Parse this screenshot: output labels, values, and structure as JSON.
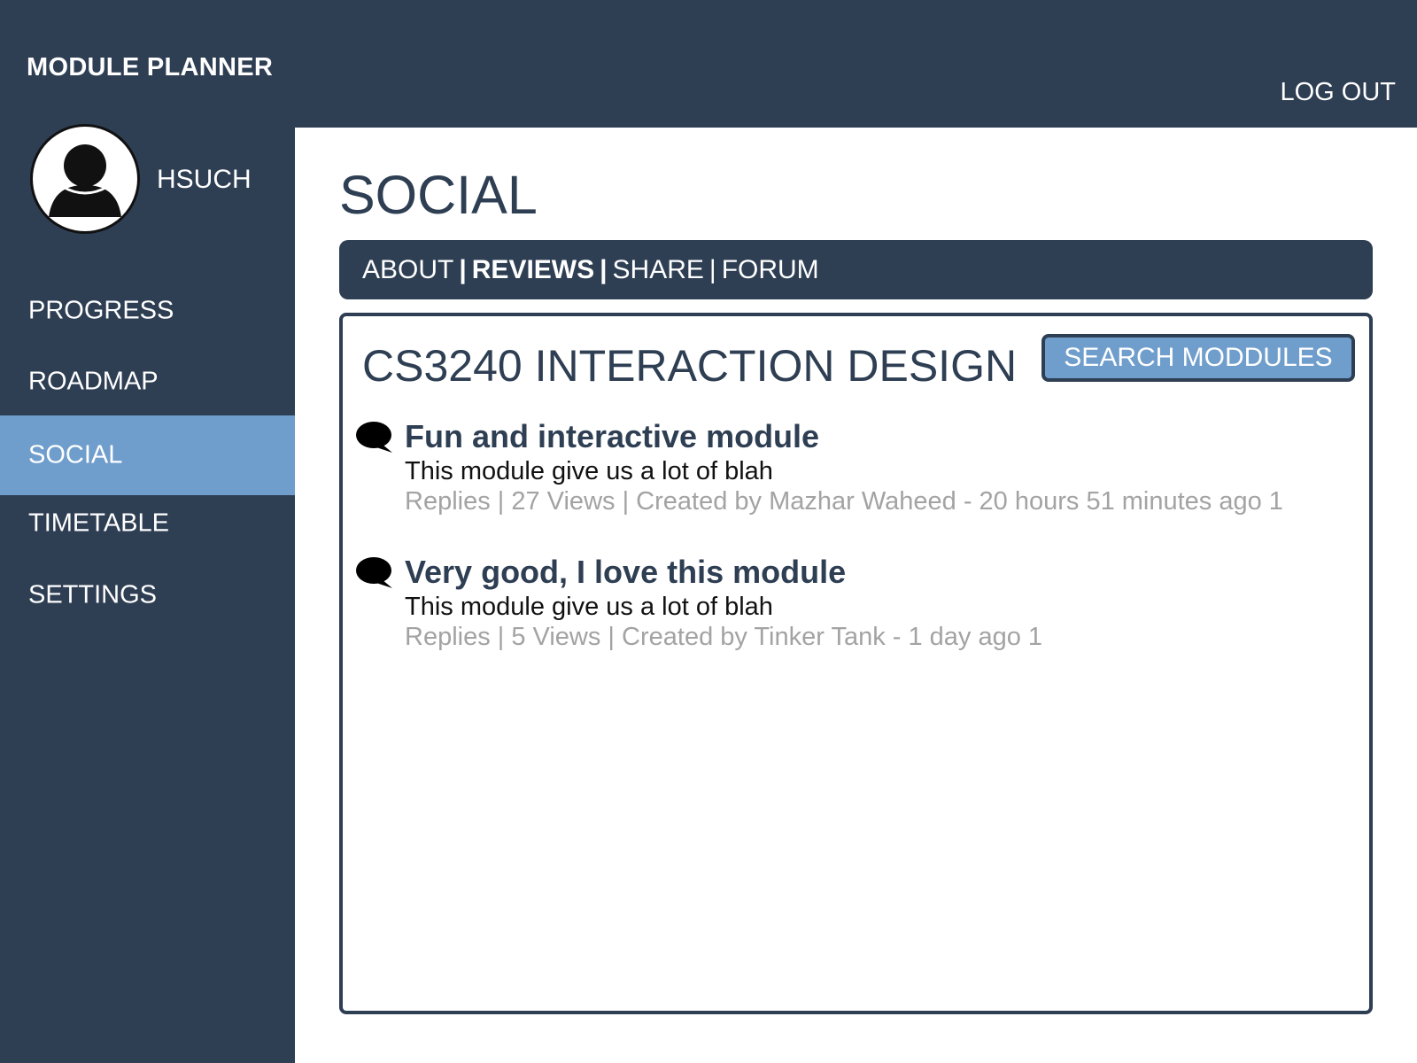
{
  "app": {
    "title": "MODULE PLANNER",
    "logout_label": "LOG OUT"
  },
  "user": {
    "name": "HSUCH",
    "avatar_icon": "user-silhouette-icon"
  },
  "sidebar": {
    "items": [
      {
        "label": "PROGRESS"
      },
      {
        "label": "ROADMAP"
      },
      {
        "label": "SOCIAL"
      },
      {
        "label": "TIMETABLE"
      },
      {
        "label": "SETTINGS"
      }
    ],
    "active": "SOCIAL"
  },
  "main": {
    "title": "SOCIAL",
    "tabs": [
      {
        "label": "ABOUT"
      },
      {
        "label": "REVIEWS"
      },
      {
        "label": "SHARE"
      },
      {
        "label": "FORUM"
      }
    ],
    "active_tab": "REVIEWS",
    "separator": "|"
  },
  "panel": {
    "module_title": "CS3240 INTERACTION DESIGN",
    "search_label": "SEARCH MODDULES",
    "reviews": [
      {
        "title": "Fun and interactive module",
        "body": "This module give us a lot of blah",
        "meta": "Replies | 27 Views | Created by Mazhar Waheed - 20 hours 51 minutes ago 1",
        "icon": "speech-bubble-icon"
      },
      {
        "title": "Very good, I love this module",
        "body": "This module give us a lot of blah",
        "meta": "Replies | 5 Views | Created by Tinker Tank - 1 day ago 1",
        "icon": "speech-bubble-icon"
      }
    ]
  },
  "colors": {
    "navy": "#2e3e53",
    "accent": "#6f9dcc",
    "meta_gray": "#a3a3a3"
  }
}
